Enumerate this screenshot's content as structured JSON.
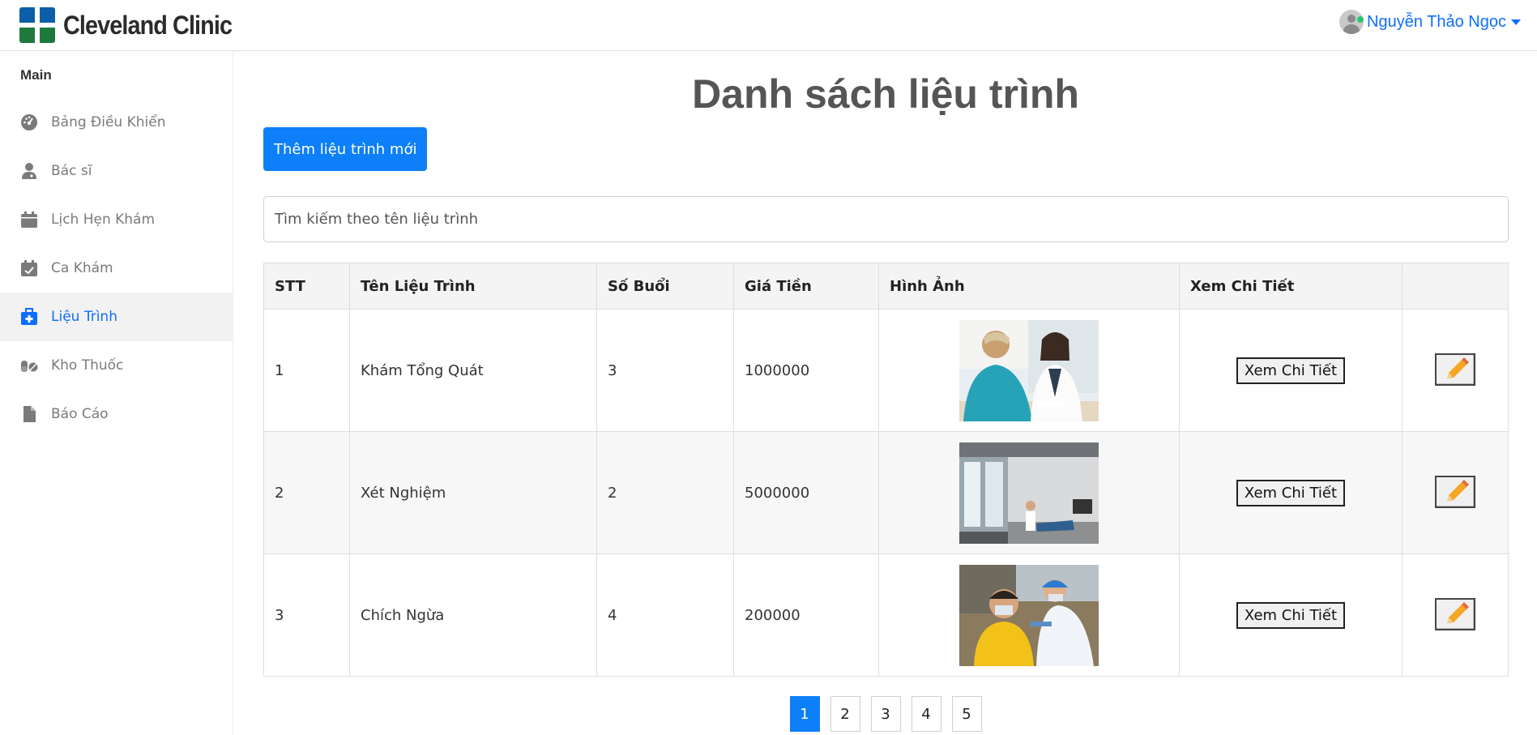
{
  "brand": {
    "name": "Cleveland Clinic"
  },
  "user": {
    "name": "Nguyễn Thảo Ngọc"
  },
  "sidebar": {
    "section": "Main",
    "items": [
      {
        "label": "Bảng Điều Khiển",
        "icon": "dashboard-icon"
      },
      {
        "label": "Bác sĩ",
        "icon": "doctor-icon"
      },
      {
        "label": "Lịch Hẹn Khám",
        "icon": "calendar-icon"
      },
      {
        "label": "Ca Khám",
        "icon": "calendar-check-icon"
      },
      {
        "label": "Liệu Trình",
        "icon": "medical-kit-icon",
        "active": true
      },
      {
        "label": "Kho Thuốc",
        "icon": "pills-icon"
      },
      {
        "label": "Báo Cáo",
        "icon": "file-icon"
      }
    ]
  },
  "main": {
    "title": "Danh sách liệu trình",
    "add_button": "Thêm liệu trình mới",
    "search_placeholder": "Tìm kiếm theo tên liệu trình"
  },
  "table": {
    "headers": [
      "STT",
      "Tên Liệu Trình",
      "Số Buổi",
      "Giá Tiền",
      "Hình Ảnh",
      "Xem Chi Tiết",
      ""
    ],
    "rows": [
      {
        "stt": "1",
        "name": "Khám Tổng Quát",
        "sessions": "3",
        "price": "1000000",
        "image": "doctor-consultation-photo",
        "detail": "Xem Chi Tiết"
      },
      {
        "stt": "2",
        "name": "Xét Nghiệm",
        "sessions": "2",
        "price": "5000000",
        "image": "lab-room-photo",
        "detail": "Xem Chi Tiết"
      },
      {
        "stt": "3",
        "name": "Chích Ngừa",
        "sessions": "4",
        "price": "200000",
        "image": "vaccination-photo",
        "detail": "Xem Chi Tiết"
      }
    ]
  },
  "pagination": {
    "pages": [
      "1",
      "2",
      "3",
      "4",
      "5"
    ],
    "current": "1"
  },
  "colors": {
    "primary": "#0d7ff8",
    "link": "#0d6efd"
  }
}
